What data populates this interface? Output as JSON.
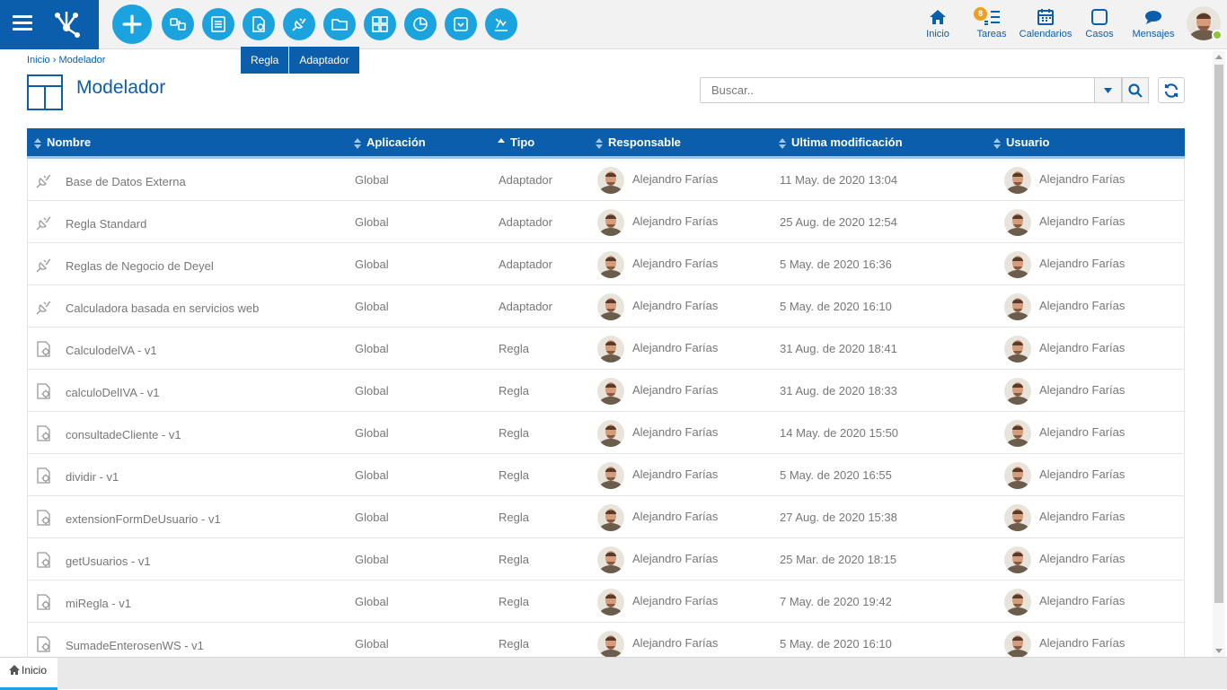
{
  "header": {
    "tools": [
      {
        "name": "add",
        "icon": "plus-icon"
      },
      {
        "name": "forms",
        "icon": "forms-icon"
      },
      {
        "name": "entities",
        "icon": "entity-icon"
      },
      {
        "name": "rules",
        "icon": "rule-icon"
      },
      {
        "name": "adapters",
        "icon": "adapter-icon"
      },
      {
        "name": "folders",
        "icon": "folder-icon"
      },
      {
        "name": "applications",
        "icon": "grid-icon"
      },
      {
        "name": "reports",
        "icon": "chart-icon"
      },
      {
        "name": "events",
        "icon": "event-icon"
      },
      {
        "name": "process",
        "icon": "process-icon"
      }
    ],
    "dropdown": [
      "Regla",
      "Adaptador"
    ],
    "nav": {
      "home": "Inicio",
      "tasks": "Tareas",
      "tasks_badge": "8",
      "calendars": "Calendarios",
      "cases": "Casos",
      "messages": "Mensajes"
    }
  },
  "breadcrumb": {
    "home": "Inicio",
    "sep": " › ",
    "current": "Modelador"
  },
  "page_title": "Modelador",
  "search": {
    "placeholder": "Buscar.."
  },
  "table": {
    "columns": [
      "Nombre",
      "Aplicación",
      "Tipo",
      "Responsable",
      "Ultima modificación",
      "Usuario"
    ],
    "rows": [
      {
        "icon": "adapter",
        "name": "Base de Datos Externa",
        "app": "Global",
        "type": "Adaptador",
        "owner": "Alejandro Farías",
        "modified": "11 May. de 2020 13:04",
        "user": "Alejandro Farías"
      },
      {
        "icon": "adapter",
        "name": "Regla Standard",
        "app": "Global",
        "type": "Adaptador",
        "owner": "Alejandro Farías",
        "modified": "25 Aug. de 2020 12:54",
        "user": "Alejandro Farías"
      },
      {
        "icon": "adapter",
        "name": "Reglas de Negocio de Deyel",
        "app": "Global",
        "type": "Adaptador",
        "owner": "Alejandro Farías",
        "modified": "5 May. de 2020 16:36",
        "user": "Alejandro Farías"
      },
      {
        "icon": "adapter",
        "name": "Calculadora basada en servicios web",
        "app": "Global",
        "type": "Adaptador",
        "owner": "Alejandro Farías",
        "modified": "5 May. de 2020 16:10",
        "user": "Alejandro Farías"
      },
      {
        "icon": "rule",
        "name": "CalculodelVA - v1",
        "app": "Global",
        "type": "Regla",
        "owner": "Alejandro Farías",
        "modified": "31 Aug. de 2020 18:41",
        "user": "Alejandro Farías"
      },
      {
        "icon": "rule",
        "name": "calculoDelIVA - v1",
        "app": "Global",
        "type": "Regla",
        "owner": "Alejandro Farías",
        "modified": "31 Aug. de 2020 18:33",
        "user": "Alejandro Farías"
      },
      {
        "icon": "rule",
        "name": "consultadeCliente - v1",
        "app": "Global",
        "type": "Regla",
        "owner": "Alejandro Farías",
        "modified": "14 May. de 2020 15:50",
        "user": "Alejandro Farías"
      },
      {
        "icon": "rule",
        "name": "dividir - v1",
        "app": "Global",
        "type": "Regla",
        "owner": "Alejandro Farías",
        "modified": "5 May. de 2020 16:55",
        "user": "Alejandro Farías"
      },
      {
        "icon": "rule",
        "name": "extensionFormDeUsuario - v1",
        "app": "Global",
        "type": "Regla",
        "owner": "Alejandro Farías",
        "modified": "27 Aug. de 2020 15:38",
        "user": "Alejandro Farías"
      },
      {
        "icon": "rule",
        "name": "getUsuarios - v1",
        "app": "Global",
        "type": "Regla",
        "owner": "Alejandro Farías",
        "modified": "25 Mar. de 2020 18:15",
        "user": "Alejandro Farías"
      },
      {
        "icon": "rule",
        "name": "miRegla - v1",
        "app": "Global",
        "type": "Regla",
        "owner": "Alejandro Farías",
        "modified": "7 May. de 2020 19:42",
        "user": "Alejandro Farías"
      },
      {
        "icon": "rule",
        "name": "SumadeEnterosenWS - v1",
        "app": "Global",
        "type": "Regla",
        "owner": "Alejandro Farías",
        "modified": "5 May. de 2020 16:10",
        "user": "Alejandro Farías"
      }
    ]
  },
  "bottom_tab": "Inicio",
  "colors": {
    "primary": "#0b5eab",
    "accent": "#1aa3df",
    "badge": "#f0a020",
    "online": "#8cc63f"
  }
}
